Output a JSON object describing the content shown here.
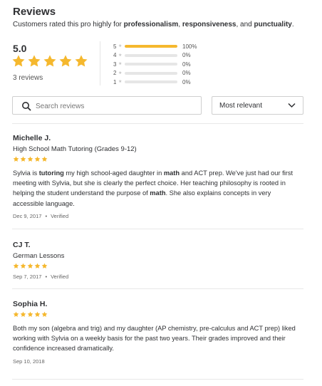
{
  "reviews_section": {
    "title": "Reviews",
    "subtitle_parts": [
      {
        "text": "Customers rated this pro highly for ",
        "bold": false
      },
      {
        "text": "professionalism",
        "bold": true
      },
      {
        "text": ", ",
        "bold": false
      },
      {
        "text": "responsiveness",
        "bold": true
      },
      {
        "text": ", and ",
        "bold": false
      },
      {
        "text": "punctuality",
        "bold": true
      },
      {
        "text": ".",
        "bold": false
      }
    ]
  },
  "summary": {
    "score": "5.0",
    "review_count": "3 reviews",
    "star_rating": 5,
    "star_color": "#f5b82e"
  },
  "distribution": [
    {
      "stars": "5",
      "percent": "100%",
      "fraction": 1.0
    },
    {
      "stars": "4",
      "percent": "0%",
      "fraction": 0
    },
    {
      "stars": "3",
      "percent": "0%",
      "fraction": 0
    },
    {
      "stars": "2",
      "percent": "0%",
      "fraction": 0
    },
    {
      "stars": "1",
      "percent": "0%",
      "fraction": 0
    }
  ],
  "search": {
    "placeholder": "Search reviews",
    "value": ""
  },
  "sort": {
    "selected": "Most relevant"
  },
  "reviews": [
    {
      "name": "Michelle J.",
      "service": "High School Math Tutoring (Grades 9-12)",
      "rating": 5,
      "text_parts": [
        {
          "text": "Sylvia is ",
          "bold": false
        },
        {
          "text": "tutoring",
          "bold": true
        },
        {
          "text": " my high school-aged daughter in ",
          "bold": false
        },
        {
          "text": "math",
          "bold": true
        },
        {
          "text": " and ACT prep. We've just had our first meeting with Sylvia, but she is clearly the perfect choice. Her teaching philosophy is rooted in helping the student understand the purpose of ",
          "bold": false
        },
        {
          "text": "math",
          "bold": true
        },
        {
          "text": ". She also explains concepts in very accessible language.",
          "bold": false
        }
      ],
      "date": "Dec 9, 2017",
      "verified": "Verified"
    },
    {
      "name": "CJ T.",
      "service": "German Lessons",
      "rating": 5,
      "text_parts": [],
      "date": "Sep 7, 2017",
      "verified": "Verified"
    },
    {
      "name": "Sophia H.",
      "service": "",
      "rating": 5,
      "text_parts": [
        {
          "text": "Both my son (algebra and trig) and my daughter (AP chemistry, pre-calculus and ACT prep) liked working with Sylvia on a weekly basis for the past two years. Their grades improved and their confidence increased dramatically.",
          "bold": false
        }
      ],
      "date": "Sep 10, 2018",
      "verified": ""
    }
  ],
  "icons": {
    "search": "search-icon",
    "sort": "chevron-down-icon",
    "star": "star-icon"
  }
}
